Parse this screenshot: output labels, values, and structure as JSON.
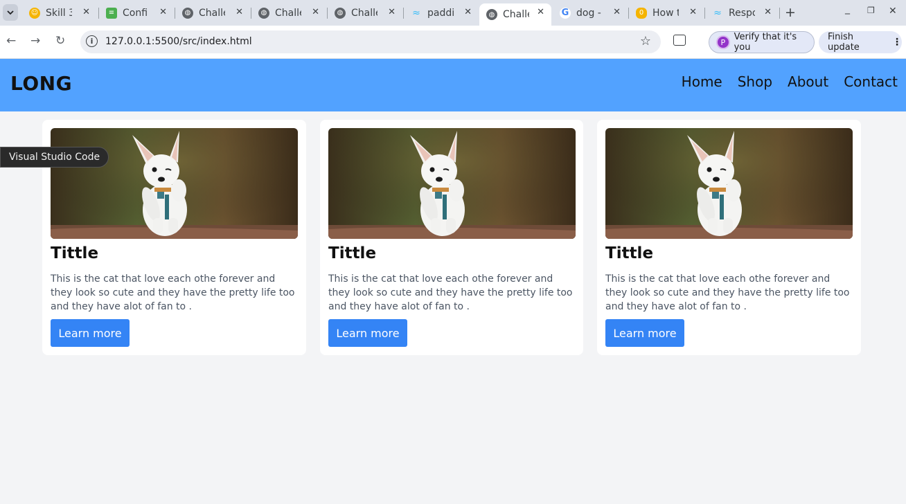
{
  "browser": {
    "tabs": [
      {
        "title": "Skill 3",
        "icon": "emoji-icon",
        "color": "#f5b400"
      },
      {
        "title": "Confi",
        "icon": "book-icon",
        "color": "#4caf50"
      },
      {
        "title": "Challe",
        "icon": "globe-icon",
        "color": "#5f6368"
      },
      {
        "title": "Challe",
        "icon": "globe-icon",
        "color": "#5f6368"
      },
      {
        "title": "Challe",
        "icon": "globe-icon",
        "color": "#5f6368"
      },
      {
        "title": "paddi",
        "icon": "tailwind-icon",
        "color": "#38bdf8"
      },
      {
        "title": "Challe",
        "icon": "globe-icon",
        "color": "#5f6368",
        "active": true
      },
      {
        "title": "dog -",
        "icon": "google-icon",
        "color": "#4285f4"
      },
      {
        "title": "How t",
        "icon": "coin-icon",
        "color": "#f5b400"
      },
      {
        "title": "Respo",
        "icon": "tailwind-icon",
        "color": "#38bdf8"
      }
    ],
    "url": "127.0.0.1:5500/src/index.html",
    "verify_label": "Verify that it's you",
    "avatar_letter": "P",
    "finish_update_label": "Finish update"
  },
  "site": {
    "brand": "LONG",
    "nav": [
      "Home",
      "Shop",
      "About",
      "Contact"
    ],
    "header_color": "#52a2ff",
    "cards": [
      {
        "title": "Tittle",
        "description": "This is the cat that love each othe forever and they look so cute and they have the pretty life too and they have alot of fan to .",
        "button": "Learn more"
      },
      {
        "title": "Tittle",
        "description": "This is the cat that love each othe forever and they look so cute and they have the pretty life too and they have alot of fan to .",
        "button": "Learn more"
      },
      {
        "title": "Tittle",
        "description": "This is the cat that love each othe forever and they look so cute and they have the pretty life too and they have alot of fan to .",
        "button": "Learn more"
      }
    ],
    "button_color": "#3484f5"
  },
  "tooltip": "Visual Studio Code"
}
